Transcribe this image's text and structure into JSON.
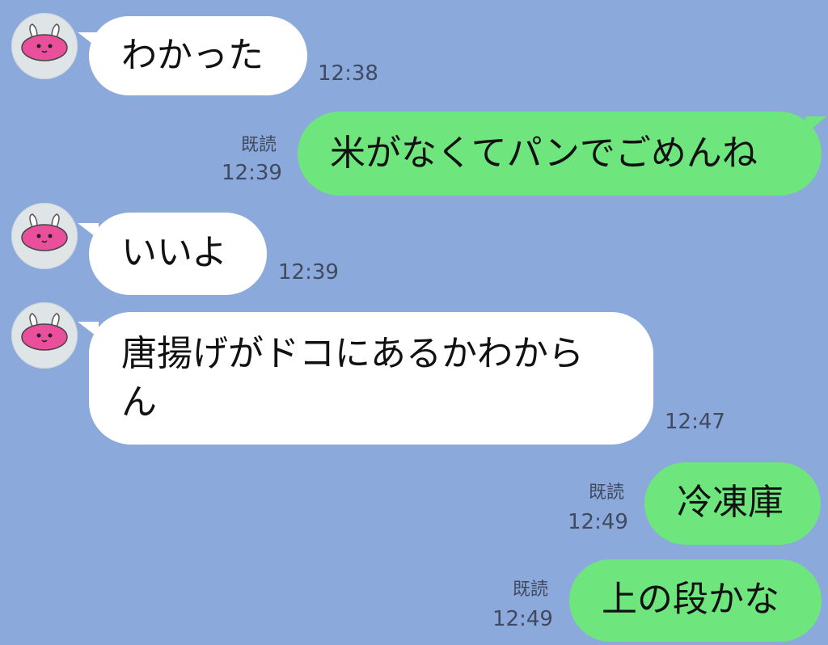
{
  "messages": [
    {
      "side": "received",
      "text": "わかった",
      "time": "12:38"
    },
    {
      "side": "sent",
      "text": "米がなくてパンでごめんね",
      "read": "既読",
      "time": "12:39"
    },
    {
      "side": "received",
      "text": "いいよ",
      "time": "12:39"
    },
    {
      "side": "received",
      "text": "唐揚げがドコにあるかわから",
      "text2": "ん",
      "time": "12:47"
    },
    {
      "side": "sent",
      "text": "冷凍庫",
      "read": "既読",
      "time": "12:49"
    },
    {
      "side": "sent",
      "text": "上の段かな",
      "read": "既読",
      "time": "12:49"
    }
  ],
  "colors": {
    "background": "#8ca9db",
    "received_bubble": "#ffffff",
    "sent_bubble": "#6ee57d",
    "meta_text": "#3f4a5f"
  },
  "icons": {
    "avatar": "pink-bunny-avatar-icon"
  }
}
